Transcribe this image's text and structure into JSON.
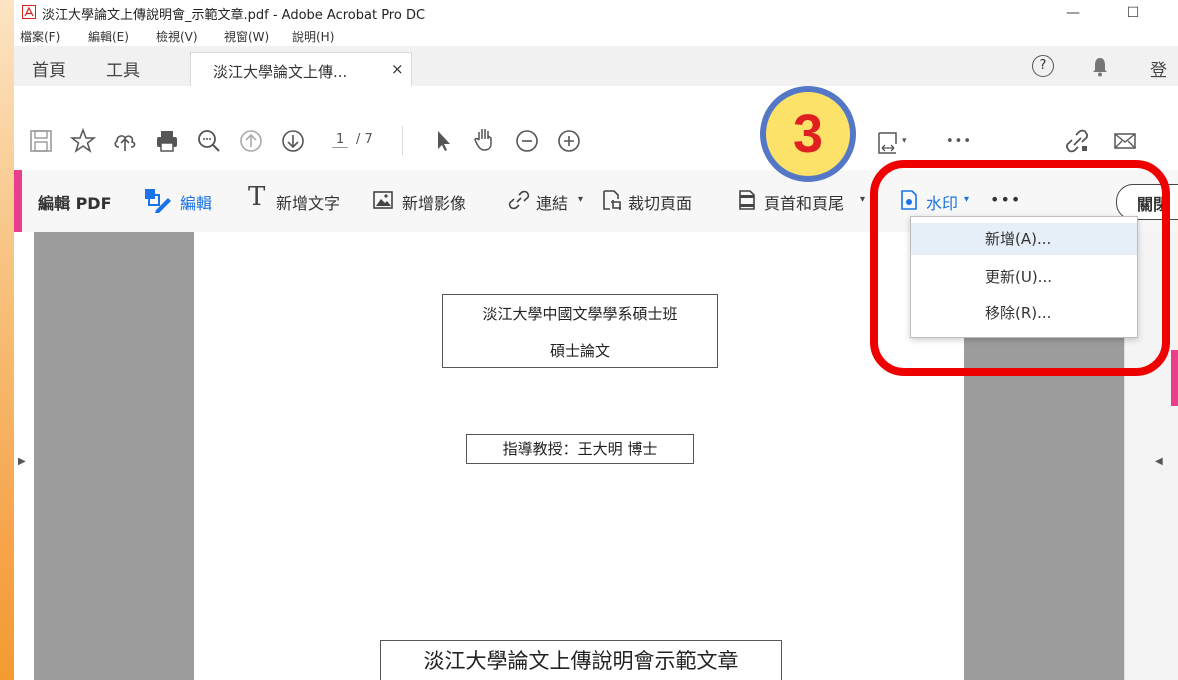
{
  "window": {
    "title": "淡江大學論文上傳說明會_示範文章.pdf - Adobe Acrobat Pro DC",
    "minimize": "—",
    "maximize": "☐"
  },
  "menubar": [
    "檔案(F)",
    "編輯(E)",
    "檢視(V)",
    "視窗(W)",
    "說明(H)"
  ],
  "tabs": {
    "home": "首頁",
    "tools": "工具",
    "document": "淡江大學論文上傳...",
    "close": "×",
    "help_icon": "?",
    "sign_in": "登"
  },
  "toolbar": {
    "page_current": "1",
    "page_total": "/ 7",
    "more": "•••"
  },
  "editbar": {
    "title": "編輯 PDF",
    "edit": "編輯",
    "add_text": "新增文字",
    "add_image": "新增影像",
    "link": "連結",
    "crop": "裁切頁面",
    "header_footer": "頁首和頁尾",
    "watermark": "水印",
    "more": "•••",
    "close": "關閉"
  },
  "watermark_menu": {
    "items": [
      {
        "label": "新增(A)...",
        "highlighted": true
      },
      {
        "label": "更新(U)...",
        "highlighted": false
      },
      {
        "label": "移除(R)...",
        "highlighted": false
      }
    ]
  },
  "document": {
    "line1": "淡江大學中國文學學系碩士班",
    "line2": "碩士論文",
    "advisor": "指導教授：王大明 博士",
    "paper_title": "淡江大學論文上傳說明會示範文章"
  },
  "annotation": {
    "step_number": "3",
    "highlight_color": "#ee0000",
    "circle_fill": "#fde26a",
    "circle_border": "#5478c6"
  },
  "colors": {
    "accent_pink": "#e83e8c",
    "link_blue": "#1a73e8"
  }
}
